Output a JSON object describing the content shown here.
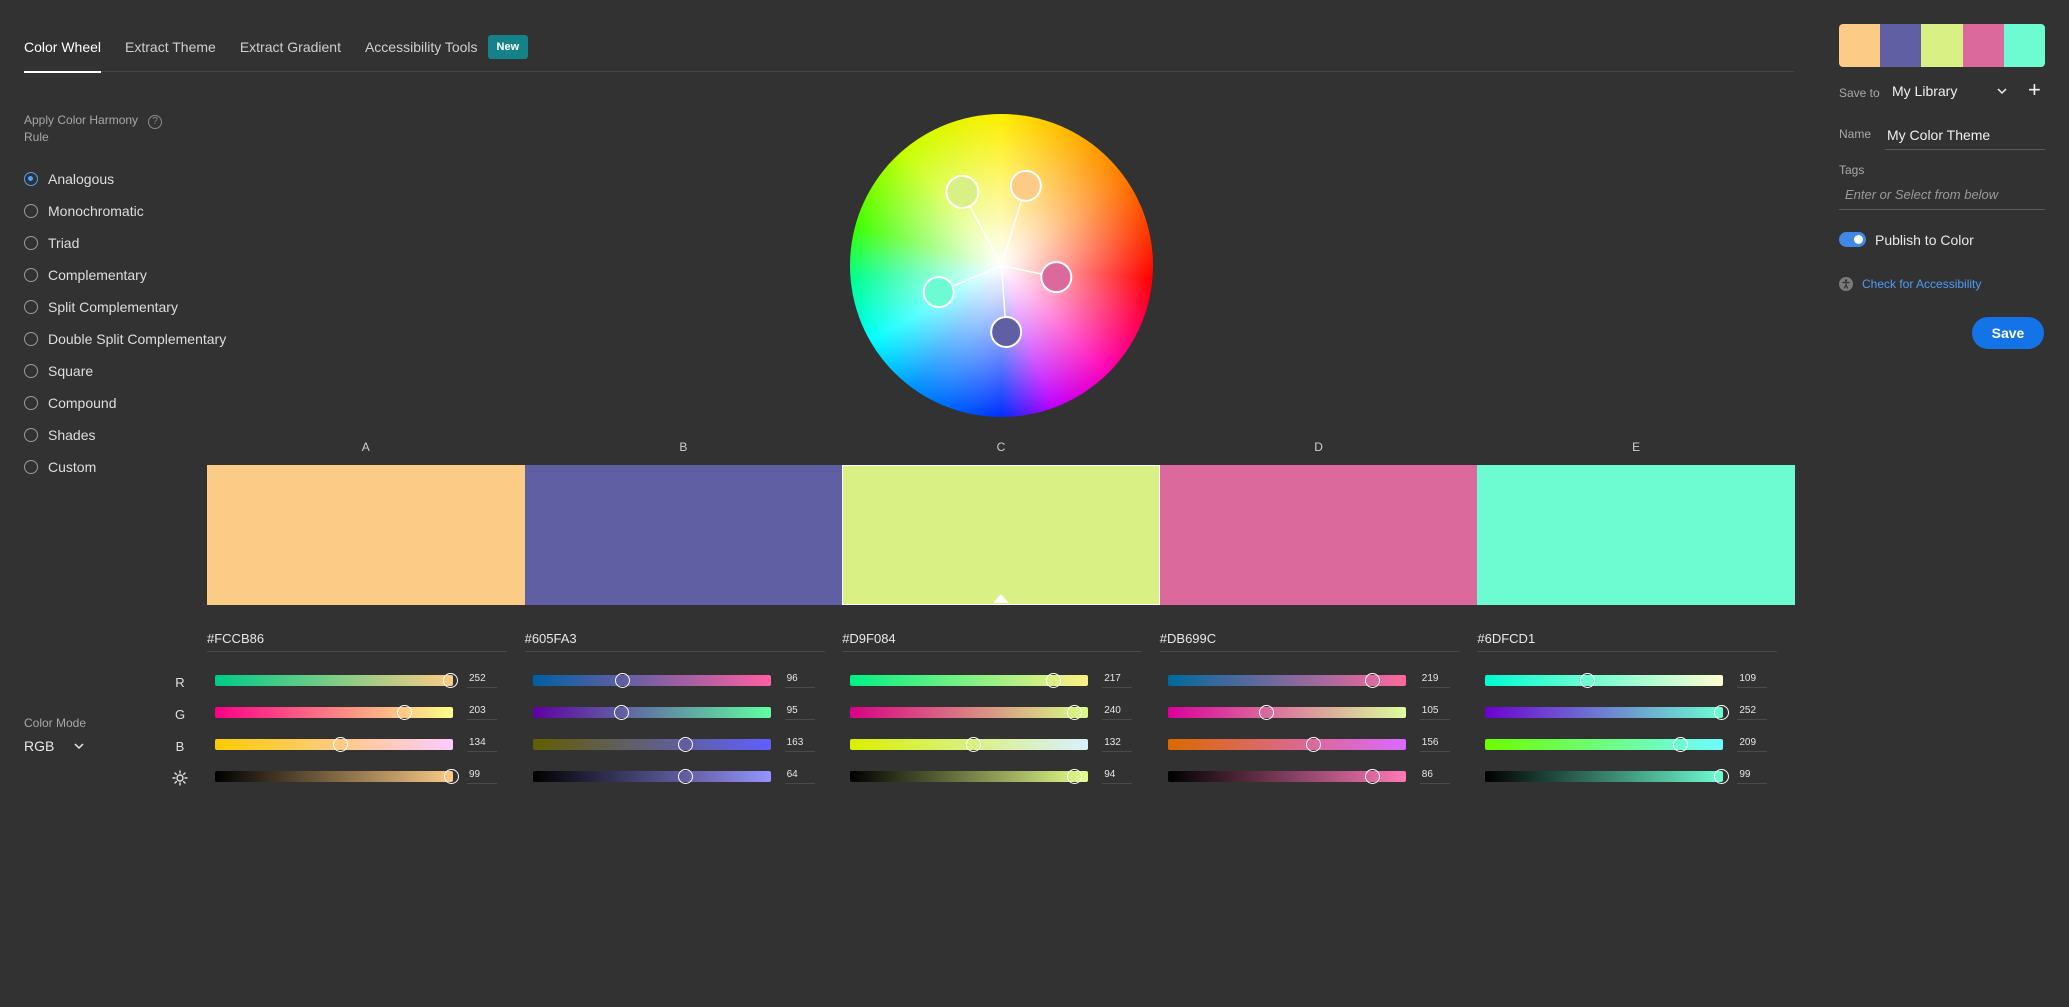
{
  "tabs": [
    {
      "label": "Color Wheel",
      "active": true
    },
    {
      "label": "Extract Theme",
      "active": false
    },
    {
      "label": "Extract Gradient",
      "active": false
    },
    {
      "label": "Accessibility Tools",
      "active": false
    }
  ],
  "new_badge": "New",
  "harmony": {
    "title": "Apply Color Harmony Rule",
    "help_icon": "question-icon",
    "rules": [
      "Analogous",
      "Monochromatic",
      "Triad",
      "Complementary",
      "Split Complementary",
      "Double Split Complementary",
      "Square",
      "Compound",
      "Shades",
      "Custom"
    ],
    "selected": "Analogous"
  },
  "swatch_labels": [
    "A",
    "B",
    "C",
    "D",
    "E"
  ],
  "swatches": [
    {
      "hex": "#FCCB86",
      "color": "#FCCB86",
      "r": 252,
      "g": 203,
      "b": 134,
      "brightness": 99,
      "grad_r": "linear-gradient(90deg,#00cb86,#fccb86)",
      "grad_g": "linear-gradient(90deg,#fc0086,#fcff86)",
      "grad_b": "linear-gradient(90deg,#fccb00,#fccbff)",
      "grad_v": "linear-gradient(90deg,#000000,#fccb86)"
    },
    {
      "hex": "#605FA3",
      "color": "#605FA3",
      "r": 96,
      "g": 95,
      "b": 163,
      "brightness": 64,
      "grad_r": "linear-gradient(90deg,#005fa3,#ff5fa3)",
      "grad_g": "linear-gradient(90deg,#6000a3,#60ffa3)",
      "grad_b": "linear-gradient(90deg,#605f00,#605fff)",
      "grad_v": "linear-gradient(90deg,#000000,#9694ff)"
    },
    {
      "hex": "#D9F084",
      "color": "#D9F084",
      "r": 217,
      "g": 240,
      "b": 132,
      "brightness": 94,
      "grad_r": "linear-gradient(90deg,#00f084,#fff084)",
      "grad_g": "linear-gradient(90deg,#d90084,#d9ff84)",
      "grad_b": "linear-gradient(90deg,#d9f000,#d9f0ff)",
      "grad_v": "linear-gradient(90deg,#000000,#e6ff8c)"
    },
    {
      "hex": "#DB699C",
      "color": "#DB699C",
      "r": 219,
      "g": 105,
      "b": 156,
      "brightness": 86,
      "grad_r": "linear-gradient(90deg,#00699c,#ff699c)",
      "grad_g": "linear-gradient(90deg,#db009c,#dbff9c)",
      "grad_b": "linear-gradient(90deg,#db6900,#db69ff)",
      "grad_v": "linear-gradient(90deg,#000000,#ff7ab5)"
    },
    {
      "hex": "#6DFCD1",
      "color": "#6DFCD1",
      "r": 109,
      "g": 252,
      "b": 209,
      "brightness": 99,
      "grad_r": "linear-gradient(90deg,#00fcd1,#fffcd1)",
      "grad_g": "linear-gradient(90deg,#6d00d1,#6dffd1)",
      "grad_b": "linear-gradient(90deg,#6dfc00,#6dfcff)",
      "grad_v": "linear-gradient(90deg,#000000,#6efed3)"
    }
  ],
  "selected_swatch": 2,
  "wheel": {
    "markers": [
      {
        "color": "#FCCB86",
        "angle_deg": 17,
        "radius_frac": 0.55
      },
      {
        "color": "#605FA3",
        "angle_deg": 176,
        "radius_frac": 0.44
      },
      {
        "color": "#D9F084",
        "angle_deg": 332,
        "radius_frac": 0.55
      },
      {
        "color": "#DB699C",
        "angle_deg": 102,
        "radius_frac": 0.37
      },
      {
        "color": "#6DFCD1",
        "angle_deg": 247,
        "radius_frac": 0.45
      }
    ],
    "base": 2
  },
  "row_labels": [
    "R",
    "G",
    "B"
  ],
  "brightness_icon": "sun-icon",
  "color_mode": {
    "label": "Color Mode",
    "value": "RGB",
    "icon": "chevron-down-icon"
  },
  "right_panel": {
    "save_to_label": "Save to",
    "library": "My Library",
    "library_icon": "chevron-down-icon",
    "add_icon": "plus-icon",
    "plus": "+",
    "name_label": "Name",
    "name_value": "My Color Theme",
    "tags_label": "Tags",
    "tags_placeholder": "Enter or Select from below",
    "publish_label": "Publish to Color",
    "publish_on": true,
    "accessibility_icon": "accessibility-icon",
    "accessibility_link": "Check for Accessibility",
    "save_label": "Save"
  }
}
